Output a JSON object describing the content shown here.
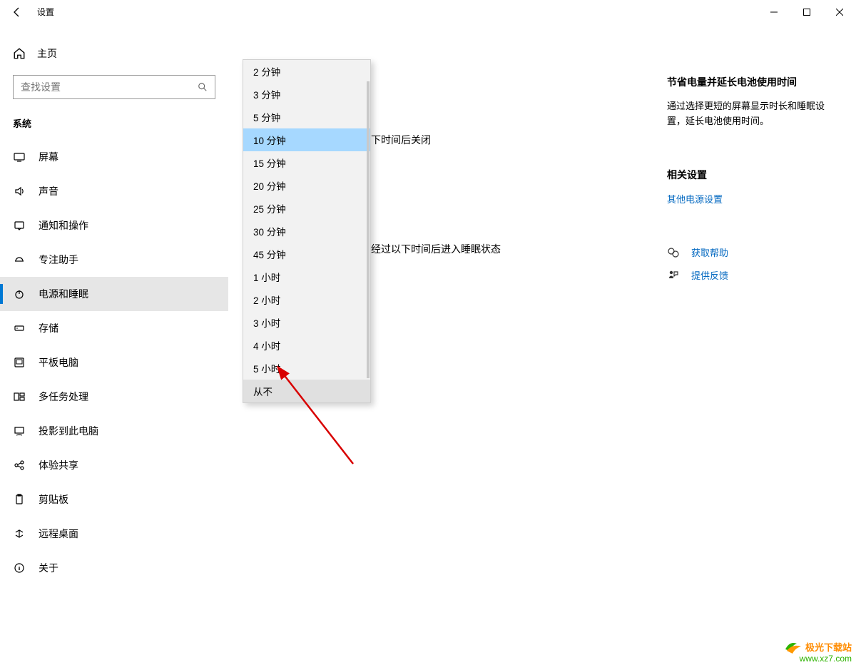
{
  "window": {
    "title": "设置",
    "minimize_tooltip": "最小化",
    "maximize_tooltip": "最大化",
    "close_tooltip": "关闭"
  },
  "sidebar": {
    "home_label": "主页",
    "search_placeholder": "查找设置",
    "section_label": "系统",
    "items": [
      {
        "id": "display",
        "label": "屏幕"
      },
      {
        "id": "sound",
        "label": "声音"
      },
      {
        "id": "notifications",
        "label": "通知和操作"
      },
      {
        "id": "focus",
        "label": "专注助手"
      },
      {
        "id": "power",
        "label": "电源和睡眠"
      },
      {
        "id": "storage",
        "label": "存储"
      },
      {
        "id": "tablet",
        "label": "平板电脑"
      },
      {
        "id": "multitask",
        "label": "多任务处理"
      },
      {
        "id": "projecting",
        "label": "投影到此电脑"
      },
      {
        "id": "shared",
        "label": "体验共享"
      },
      {
        "id": "clipboard",
        "label": "剪贴板"
      },
      {
        "id": "remote",
        "label": "远程桌面"
      },
      {
        "id": "about",
        "label": "关于"
      }
    ],
    "selected_id": "power"
  },
  "main": {
    "partial_text_1": "下时间后关闭",
    "partial_text_2": "经过以下时间后进入睡眠状态"
  },
  "dropdown": {
    "highlighted_index": 3,
    "hovered_index": 14,
    "options": [
      "2 分钟",
      "3 分钟",
      "5 分钟",
      "10 分钟",
      "15 分钟",
      "20 分钟",
      "25 分钟",
      "30 分钟",
      "45 分钟",
      "1 小时",
      "2 小时",
      "3 小时",
      "4 小时",
      "5 小时",
      "从不"
    ]
  },
  "right": {
    "tip_heading": "节省电量并延长电池使用时间",
    "tip_body": "通过选择更短的屏幕显示时长和睡眠设置，延长电池使用时间。",
    "related_heading": "相关设置",
    "related_link": "其他电源设置",
    "help_link": "获取帮助",
    "feedback_link": "提供反馈"
  },
  "watermark": {
    "line1": "极光下载站",
    "line2": "www.xz7.com"
  }
}
